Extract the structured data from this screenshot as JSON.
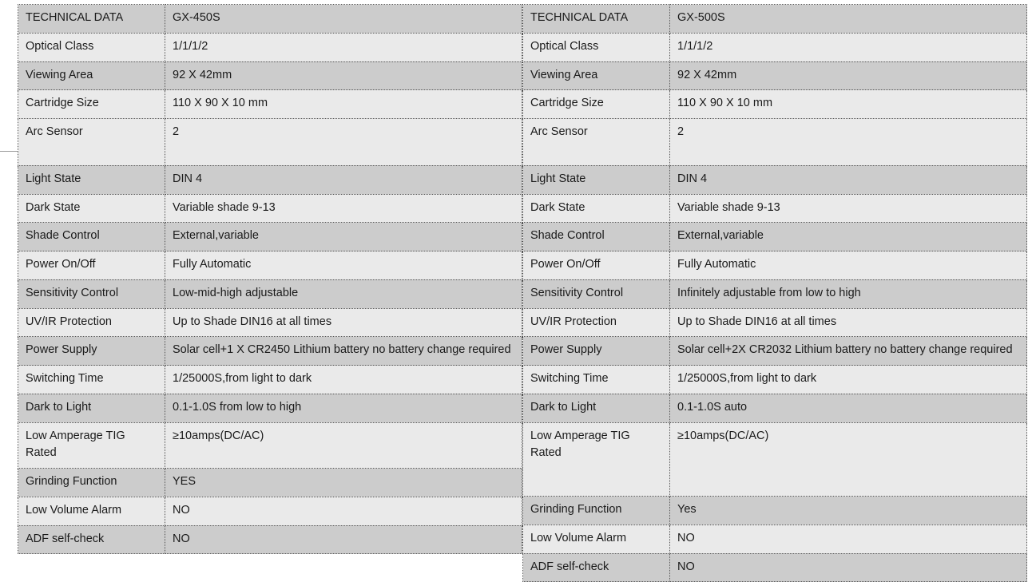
{
  "tables": [
    {
      "id": "gx-450s",
      "header": {
        "label": "TECHNICAL DATA",
        "value": "GX-450S"
      },
      "rows": [
        {
          "label": "Optical Class",
          "value": "1/1/1/2"
        },
        {
          "label": "Viewing Area",
          "value": "92 X 42mm"
        },
        {
          "label": "Cartridge Size",
          "value": "110 X 90 X 10 mm"
        },
        {
          "label": "Arc Sensor",
          "value": "2"
        },
        {
          "label": "Light State",
          "value": "DIN 4"
        },
        {
          "label": "Dark State",
          "value": "Variable shade 9-13"
        },
        {
          "label": "Shade Control",
          "value": "External,variable"
        },
        {
          "label": "Power On/Off",
          "value": "Fully Automatic"
        },
        {
          "label": "Sensitivity Control",
          "value": "Low-mid-high adjustable"
        },
        {
          "label": "UV/IR Protection",
          "value": "Up to Shade DIN16 at all times"
        },
        {
          "label": "Power Supply",
          "value": "Solar cell+1 X CR2450 Lithium battery no battery change required"
        },
        {
          "label": "Switching Time",
          "value": "1/25000S,from light to dark"
        },
        {
          "label": "Dark to Light",
          "value": "0.1-1.0S from low to high"
        },
        {
          "label": "Low Amperage TIG Rated",
          "value": "≥10amps(DC/AC)"
        },
        {
          "label": "Grinding Function",
          "value": "YES"
        },
        {
          "label": "Low Volume Alarm",
          "value": "NO"
        },
        {
          "label": "ADF self-check",
          "value": "NO"
        }
      ]
    },
    {
      "id": "gx-500s",
      "header": {
        "label": "TECHNICAL DATA",
        "value": "GX-500S"
      },
      "rows": [
        {
          "label": "Optical Class",
          "value": "1/1/1/2"
        },
        {
          "label": "Viewing Area",
          "value": "92 X 42mm"
        },
        {
          "label": "Cartridge Size",
          "value": "110 X 90 X 10 mm"
        },
        {
          "label": "Arc Sensor",
          "value": "2"
        },
        {
          "label": "Light State",
          "value": "DIN 4"
        },
        {
          "label": "Dark State",
          "value": "Variable shade 9-13"
        },
        {
          "label": "Shade Control",
          "value": "External,variable"
        },
        {
          "label": "Power On/Off",
          "value": "Fully Automatic"
        },
        {
          "label": "Sensitivity Control",
          "value": "Infinitely adjustable from low to high"
        },
        {
          "label": "UV/IR Protection",
          "value": "Up to Shade DIN16 at all times"
        },
        {
          "label": "Power Supply",
          "value": "Solar cell+2X CR2032 Lithium battery no battery change required"
        },
        {
          "label": "Switching Time",
          "value": "1/25000S,from light to dark"
        },
        {
          "label": "Dark to Light",
          "value": "0.1-1.0S auto"
        },
        {
          "label": "Low Amperage TIG Rated",
          "value": "≥10amps(DC/AC)"
        },
        {
          "label": "Grinding Function",
          "value": "Yes"
        },
        {
          "label": "Low Volume Alarm",
          "value": "NO"
        },
        {
          "label": "ADF self-check",
          "value": "NO"
        }
      ]
    }
  ],
  "colors": {
    "band_dark": "#cccccc",
    "band_light": "#eaeaea",
    "grid": "#555555",
    "text": "#1a1a1a"
  }
}
